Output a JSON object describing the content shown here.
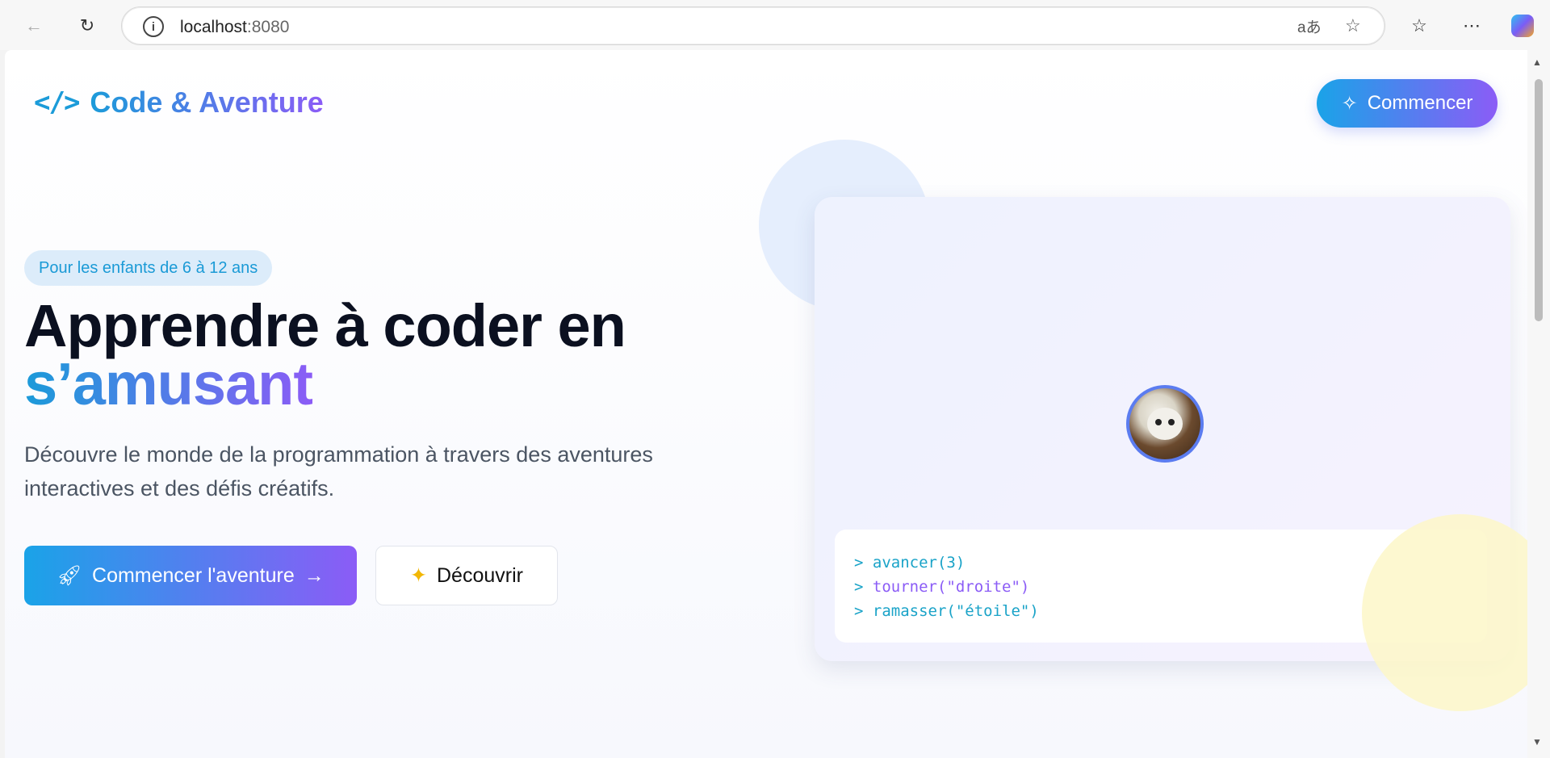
{
  "browser": {
    "url_host": "localhost",
    "url_port": ":8080"
  },
  "header": {
    "logo_icon": "</>",
    "logo_text": "Code & Aventure",
    "cta_label": "Commencer"
  },
  "hero": {
    "badge": "Pour les enfants de 6 à 12 ans",
    "title_line1": "Apprendre à coder en",
    "title_line2": "s’amusant",
    "description_line1": "Découvre le monde de la programmation à travers des aventures",
    "description_line2": "interactives et des défis créatifs.",
    "primary_button": "Commencer l'aventure",
    "secondary_button": "Découvrir"
  },
  "code_preview": {
    "lines": [
      {
        "prompt": ">",
        "cmd": "avancer",
        "args": "(3)"
      },
      {
        "prompt": ">",
        "cmd": "tourner",
        "args": "(\"droite\")"
      },
      {
        "prompt": ">",
        "cmd": "ramasser",
        "args": "(\"étoile\")"
      }
    ]
  },
  "colors": {
    "accent_start": "#1aa3e8",
    "accent_end": "#8b5cf6"
  }
}
